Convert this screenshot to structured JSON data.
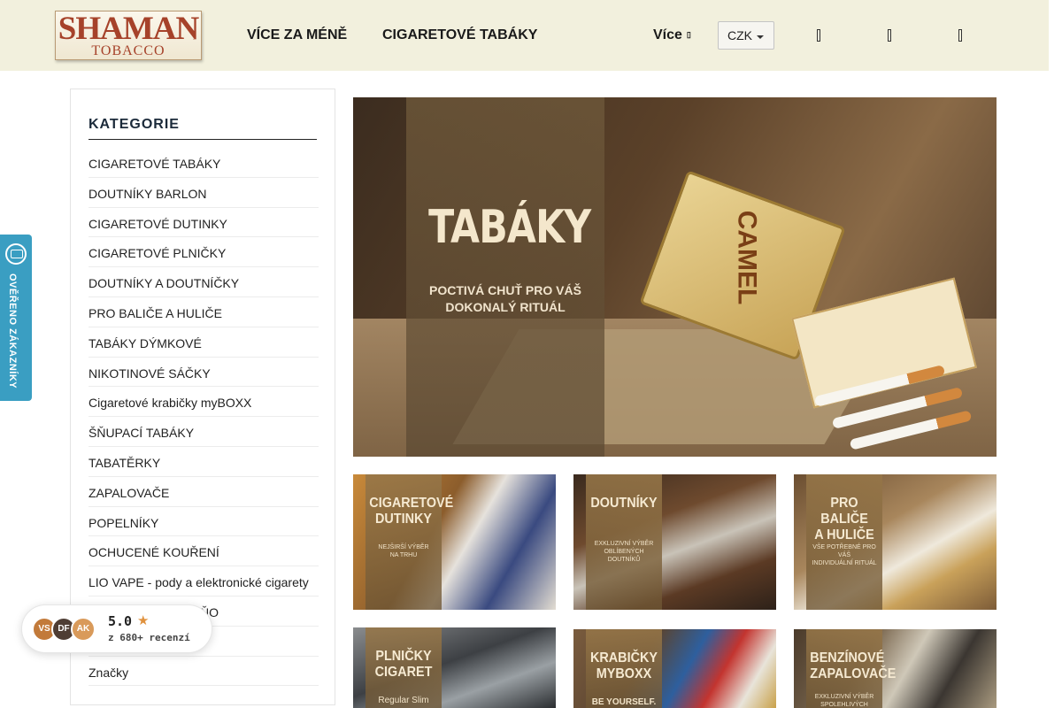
{
  "header": {
    "logo_top": "SHAMAN",
    "logo_bottom": "TOBACCO",
    "logo_mark": "S",
    "nav": [
      "VÍCE ZA MÉNĚ",
      "CIGARETOVÉ TABÁKY"
    ],
    "more_label": "Více",
    "more_caret": "▯",
    "currency": "CZK",
    "icons": [
      "search-icon",
      "user-icon",
      "cart-icon"
    ]
  },
  "sidebar": {
    "title": "KATEGORIE",
    "categories": [
      "CIGARETOVÉ TABÁKY",
      "DOUTNÍKY BARLON",
      "CIGARETOVÉ DUTINKY",
      "CIGARETOVÉ PLNIČKY",
      "DOUTNÍKY A DOUTNÍČKY",
      "PRO BALIČE A HULIČE",
      "TABÁKY DÝMKOVÉ",
      "NIKOTINOVÉ SÁČKY",
      "Cigaretové krabičky myBOXX",
      "ŠŇUPACÍ TABÁKY",
      "TABATĚRKY",
      "ZAPALOVAČE",
      "POPELNÍKY",
      "OCHUCENÉ KOUŘENÍ",
      "LIO VAPE - pody a elektronické cigarety",
      "...ŠÍ… …ŘENÍ … …ŇO",
      "…",
      "Značky"
    ]
  },
  "verified_badge": {
    "text": "OVĚŘENO ZÁKAZNÍKY",
    "color": "#3a9ec2"
  },
  "reviews": {
    "avatars": [
      "VS",
      "DF",
      "AK"
    ],
    "score": "5.0",
    "count": "z 680+ recenzí"
  },
  "hero": {
    "title": "TABÁKY",
    "subtitle_line1": "POCTIVÁ CHUŤ PRO VÁŠ",
    "subtitle_line2": "DOKONALÝ RITUÁL",
    "tin_label": "CAMEL"
  },
  "tiles": [
    {
      "title_1": "CIGARETOVÉ",
      "title_2": "DUTINKY",
      "sub_1": "NEJŠIRŠÍ VÝBĚR",
      "sub_2": "NA TRHU"
    },
    {
      "title_1": "DOUTNÍKY",
      "title_2": "",
      "sub_1": "EXKLUZIVNÍ VÝBĚR",
      "sub_2": "OBLÍBENÝCH DOUTNÍKŮ"
    },
    {
      "title_1": "PRO BALIČE",
      "title_2": "A HULIČE",
      "sub_1": "VŠE POTŘEBNÉ PRO VÁŠ",
      "sub_2": "INDIVIDUÁLNÍ RITUÁL"
    },
    {
      "title_1": "PLNIČKY",
      "title_2": "CIGARET",
      "sub_1": "Regular Slim",
      "sub_2": ""
    },
    {
      "title_1": "KRABIČKY",
      "title_2": "MYBOXX",
      "sub_1": "BE YOURSELF.",
      "sub_2": ""
    },
    {
      "title_1": "BENZÍNOVÉ",
      "title_2": "ZAPALOVAČE",
      "sub_1": "EXKLUZIVNÍ VÝBĚR",
      "sub_2": "SPOLEHLIVÝCH"
    }
  ]
}
